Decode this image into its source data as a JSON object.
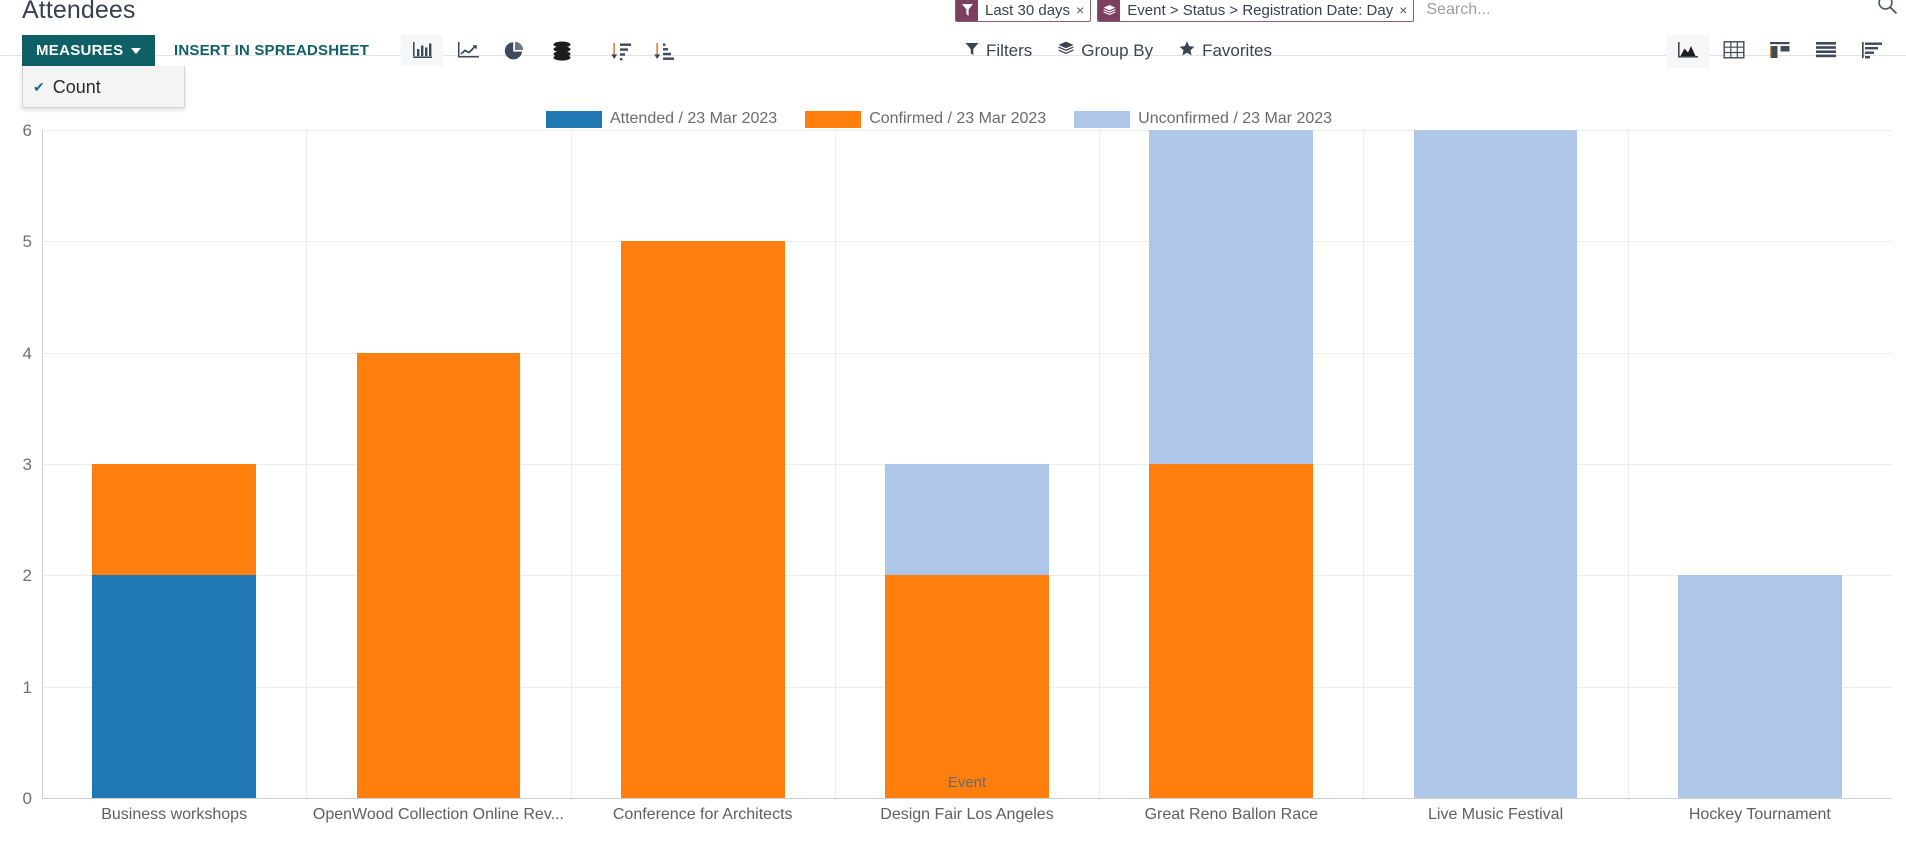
{
  "page_title": "Attendees",
  "search": {
    "placeholder": "Search...",
    "value": "",
    "magnifier_icon": "search-icon",
    "facets": [
      {
        "icon": "filter-icon",
        "label": "Last 30 days",
        "remove": "×"
      },
      {
        "icon": "layers-icon",
        "label": "Event > Status > Registration Date: Day",
        "remove": "×"
      }
    ]
  },
  "toolbar": {
    "measures_label": "MEASURES",
    "measures_open": true,
    "measures_items": [
      {
        "label": "Count",
        "checked": true,
        "check_glyph": "✔"
      }
    ],
    "insert_label": "INSERT IN SPREADSHEET",
    "chart_type_buttons": [
      {
        "name": "bar-chart-icon",
        "active": true
      },
      {
        "name": "line-chart-icon",
        "active": false
      },
      {
        "name": "pie-chart-icon",
        "active": false
      },
      {
        "name": "stacked-icon",
        "active": false
      }
    ],
    "sort_buttons": [
      {
        "name": "sort-descending-icon"
      },
      {
        "name": "sort-ascending-icon"
      }
    ],
    "actions": [
      {
        "icon": "filter-icon",
        "label": "Filters"
      },
      {
        "icon": "layers-icon",
        "label": "Group By"
      },
      {
        "icon": "star-icon",
        "label": "Favorites"
      }
    ],
    "view_switcher": [
      {
        "name": "graph-view-icon",
        "active": true
      },
      {
        "name": "pivot-view-icon",
        "active": false
      },
      {
        "name": "kanban-view-icon",
        "active": false
      },
      {
        "name": "list-view-icon",
        "active": false
      },
      {
        "name": "cohort-view-icon",
        "active": false
      }
    ]
  },
  "colors": {
    "brand_teal": "#0f5f66",
    "attended": "#1f77b4",
    "confirmed": "#ff7f0e",
    "unconfirmed": "#aec7e8",
    "facet": "#7c3f5e",
    "grid": "#ededed"
  },
  "chart_data": {
    "type": "bar",
    "stacked": true,
    "title": "",
    "xlabel": "Event",
    "ylabel": "",
    "ylim": [
      0,
      6
    ],
    "yticks": [
      0,
      1,
      2,
      3,
      4,
      5,
      6
    ],
    "grid": true,
    "legend_position": "top",
    "categories": [
      "Business workshops",
      "OpenWood Collection Online Rev...",
      "Conference for Architects",
      "Design Fair Los Angeles",
      "Great Reno Ballon Race",
      "Live Music Festival",
      "Hockey Tournament"
    ],
    "series": [
      {
        "name": "Attended / 23 Mar 2023",
        "color": "#1f77b4",
        "values": [
          2,
          0,
          0,
          0,
          0,
          0,
          0
        ]
      },
      {
        "name": "Confirmed / 23 Mar 2023",
        "color": "#ff7f0e",
        "values": [
          1,
          4,
          5,
          2,
          3,
          0,
          0
        ]
      },
      {
        "name": "Unconfirmed / 23 Mar 2023",
        "color": "#aec7e8",
        "values": [
          0,
          0,
          0,
          1,
          3,
          6,
          2
        ]
      }
    ],
    "totals": [
      3,
      4,
      5,
      3,
      6,
      6,
      2
    ]
  }
}
